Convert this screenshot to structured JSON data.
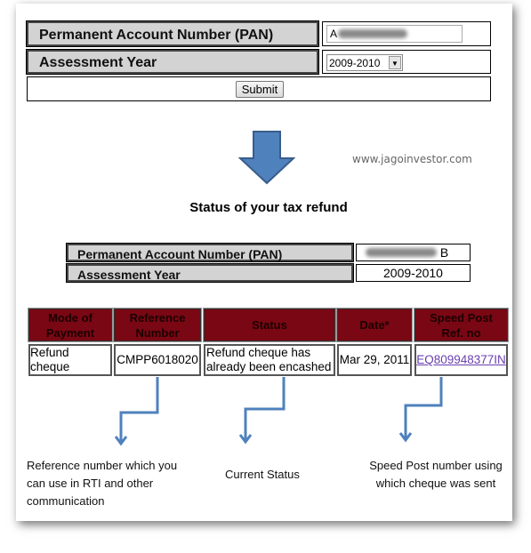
{
  "form": {
    "pan_label": "Permanent Account Number (PAN)",
    "pan_value": "A",
    "year_label": "Assessment Year",
    "year_value": "2009-2010",
    "submit_label": "Submit"
  },
  "watermark": "www.jagoinvestor.com",
  "result": {
    "title": "Status of your tax refund",
    "pan_label": "Permanent Account Number (PAN)",
    "pan_value": "B",
    "year_label": "Assessment Year",
    "year_value": "2009-2010"
  },
  "table": {
    "headers": [
      "Mode of Payment",
      "Reference Number",
      "Status",
      "Date*",
      "Speed Post Ref. no"
    ],
    "row": [
      "Refund cheque",
      "CMPP6018020",
      "Refund cheque has already been encashed",
      "Mar 29, 2011",
      "EQ809948377IN"
    ]
  },
  "notes": {
    "reference": "Reference number which you can use in RTI and other communication",
    "status": "Current Status",
    "speedpost": "Speed Post number using which cheque was sent"
  },
  "colors": {
    "header_bg": "#7a0714",
    "arrow": "#4f81bd",
    "link": "#6a3fb0"
  }
}
